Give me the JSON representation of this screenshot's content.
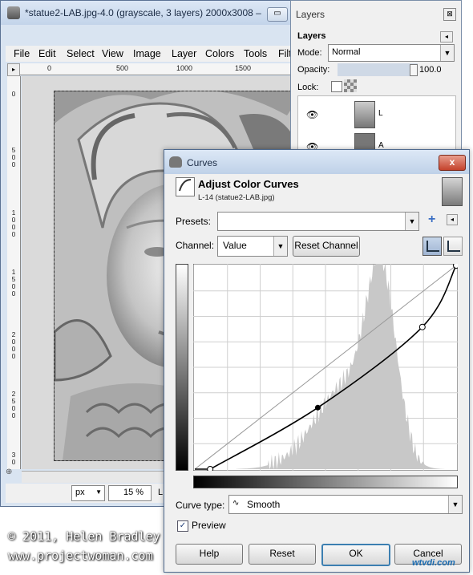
{
  "main_window": {
    "title": "*statue2-LAB.jpg-4.0 (grayscale, 3 layers) 2000x3008 –",
    "minimize": "▭",
    "menu": [
      "File",
      "Edit",
      "Select",
      "View",
      "Image",
      "Layer",
      "Colors",
      "Tools",
      "Filt"
    ],
    "ruler_top": [
      "0",
      "500",
      "1000",
      "1500"
    ],
    "ruler_left": [
      "0",
      "5\n0\n0",
      "1\n0\n0\n0",
      "1\n5\n0\n0",
      "2\n0\n0\n0",
      "2\n5\n0\n0",
      "3\n0"
    ],
    "corner_icon": "▸",
    "nav_icon": "⊕",
    "unit": "px",
    "zoom": "15 %",
    "status": "L (9"
  },
  "layers_panel": {
    "title": "Layers",
    "close": "⊠",
    "heading": "Layers",
    "menu": "◂",
    "mode_label": "Mode:",
    "mode_value": "Normal",
    "opacity_label": "Opacity:",
    "opacity_value": "100.0",
    "opacity": 1.0,
    "lock_label": "Lock:",
    "layers": [
      {
        "name": "L",
        "eye": "👁"
      },
      {
        "name": "A",
        "eye": "👁"
      }
    ]
  },
  "curves_dialog": {
    "title": "Curves",
    "close": "x",
    "heading": "Adjust Color Curves",
    "subheading": "L-14 (statue2-LAB.jpg)",
    "presets_label": "Presets:",
    "presets_value": "",
    "add_preset": "+",
    "preset_menu": "◂",
    "channel_label": "Channel:",
    "channel_value": "Value",
    "reset_channel": "Reset Channel",
    "combo_arrow": "▼",
    "curve_type_label": "Curve type:",
    "curve_type_value": "Smooth",
    "curve_type_icon": "∿",
    "preview_label": "Preview",
    "preview_checked": "✓",
    "buttons": {
      "help": "Help",
      "reset": "Reset",
      "ok": "OK",
      "cancel": "Cancel"
    },
    "curve_points": [
      [
        15,
        0
      ],
      [
        120,
        77
      ],
      [
        222,
        178
      ],
      [
        255,
        255
      ]
    ],
    "histogram_color": "#c8c8c8",
    "curve_color": "#000000"
  },
  "credits": {
    "line1": "© 2011, Helen Bradley",
    "line2": "www.projectwoman.com",
    "watermark": "wtvdi.com"
  }
}
